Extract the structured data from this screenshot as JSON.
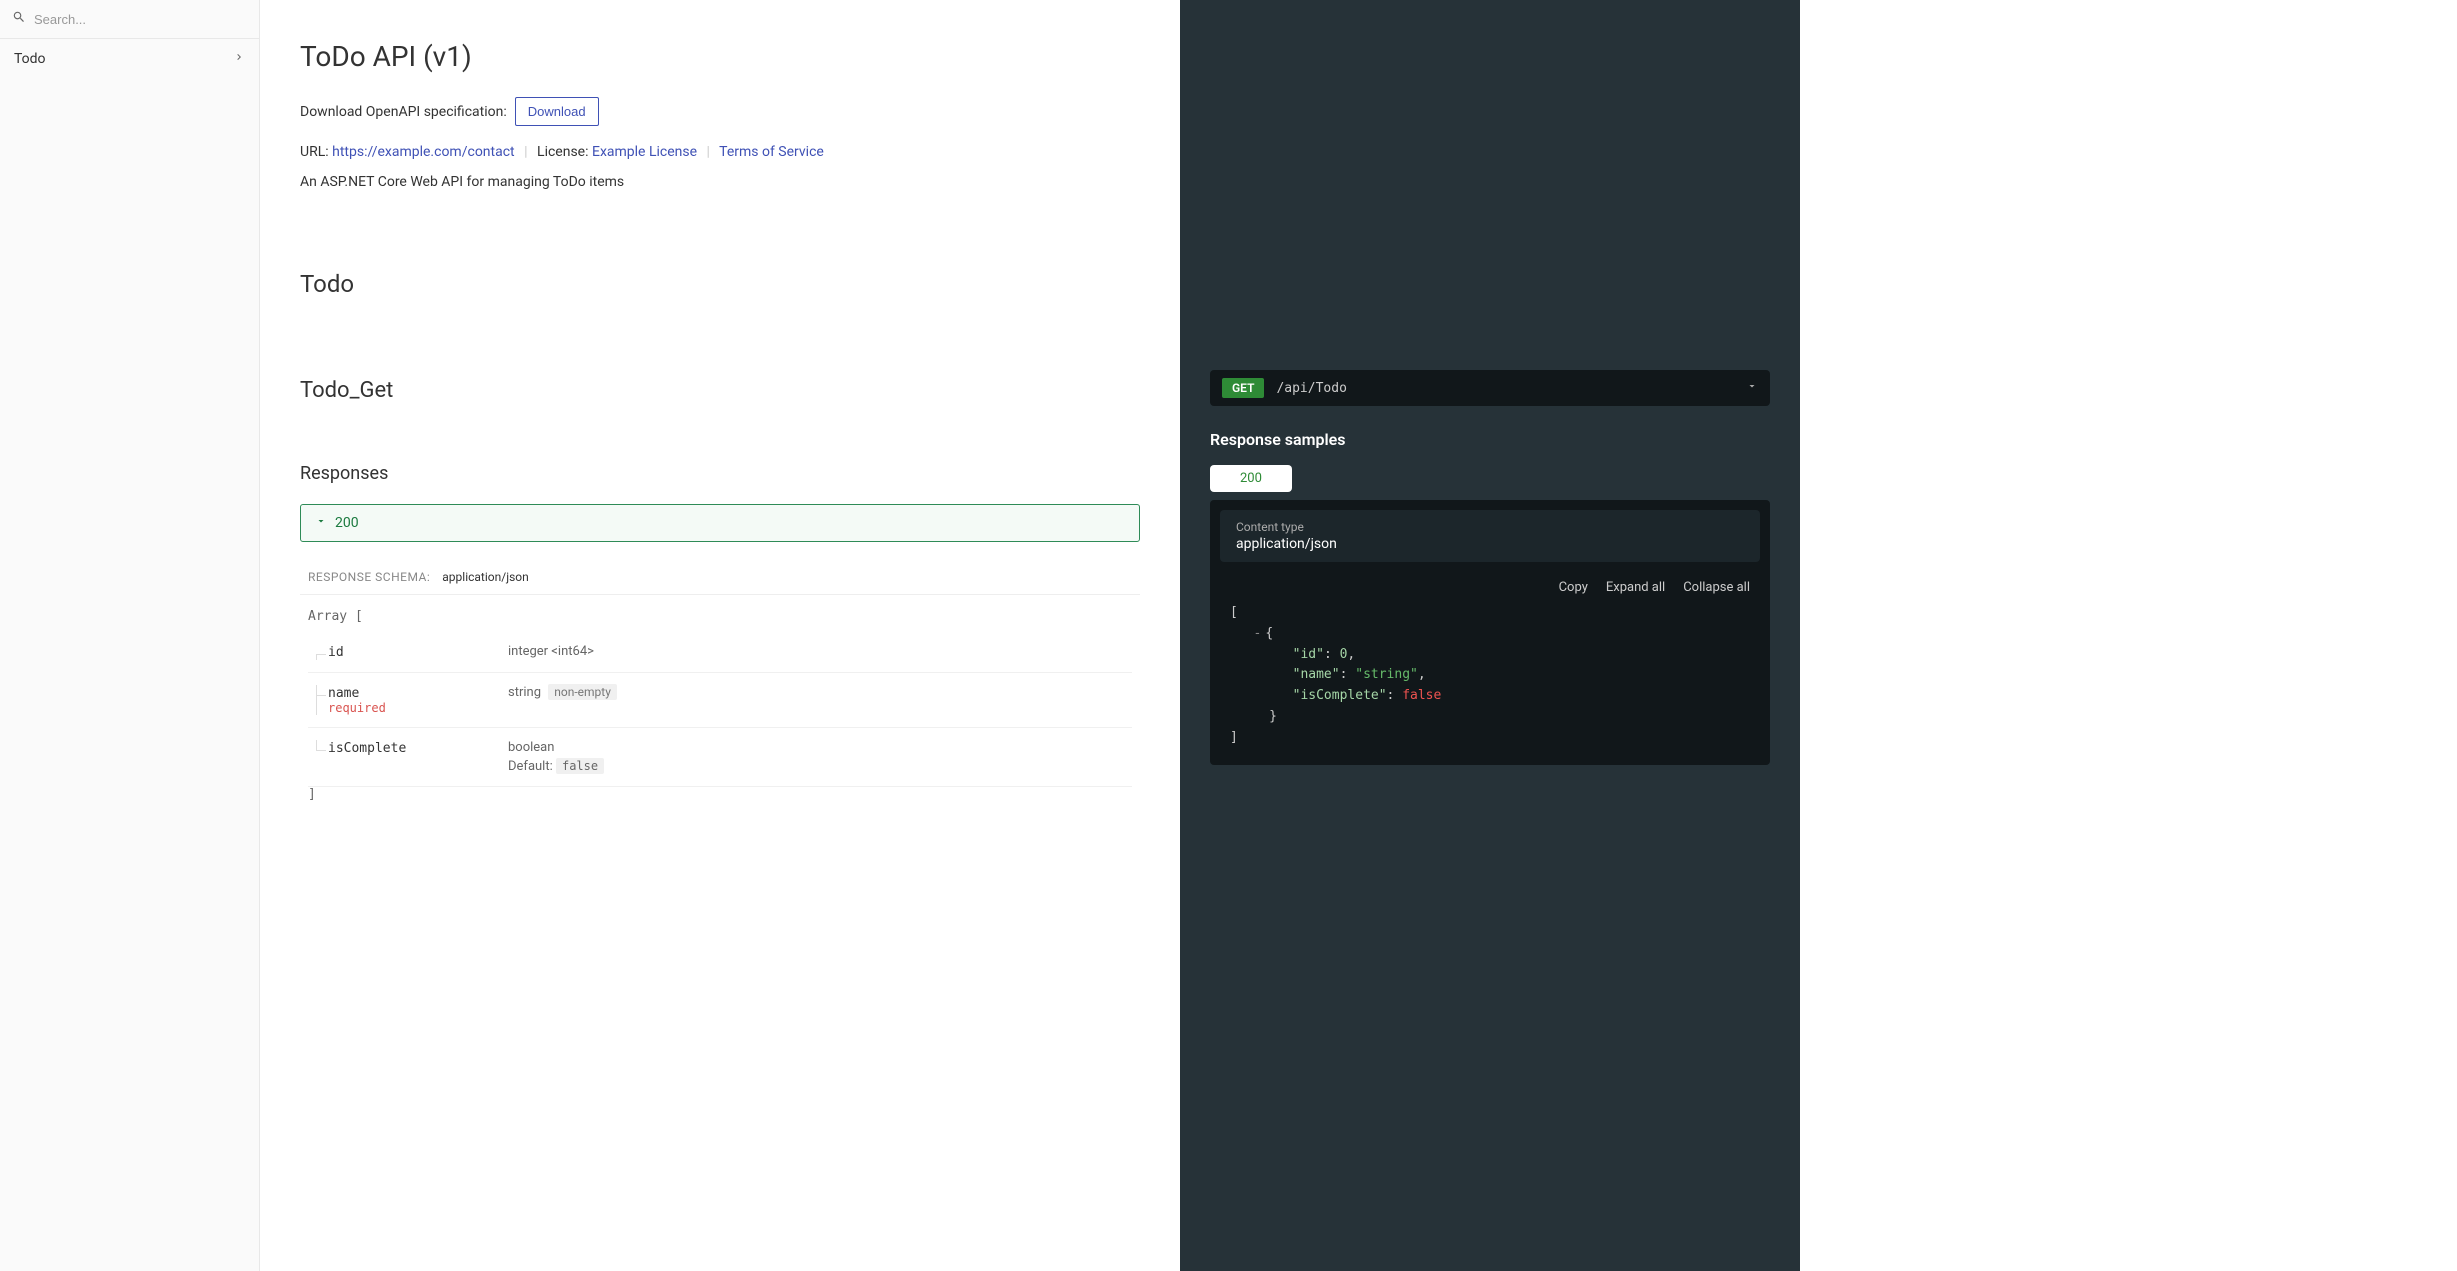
{
  "sidebar": {
    "search_placeholder": "Search...",
    "items": [
      {
        "label": "Todo"
      }
    ]
  },
  "header": {
    "title": "ToDo API (v1)",
    "spec_label": "Download OpenAPI specification:",
    "download_label": "Download",
    "url_label": "URL: ",
    "url_value": "https://example.com/contact",
    "license_label": "License: ",
    "license_value": "Example License",
    "tos_label": "Terms of Service",
    "description": "An ASP.NET Core Web API for managing ToDo items"
  },
  "tag": {
    "name": "Todo"
  },
  "operation": {
    "name": "Todo_Get",
    "responses_label": "Responses",
    "response_code": "200",
    "schema_label": "RESPONSE SCHEMA:",
    "schema_media": "application/json",
    "array_open": "Array [",
    "array_close": "]",
    "properties": [
      {
        "name": "id",
        "type": "integer <int64>"
      },
      {
        "name": "name",
        "required": "required",
        "type": "string",
        "constraint": "non-empty"
      },
      {
        "name": "isComplete",
        "type": "boolean",
        "default_label": "Default:",
        "default_value": "false"
      }
    ]
  },
  "right": {
    "method": "GET",
    "path": "/api/Todo",
    "samples_title": "Response samples",
    "tab_label": "200",
    "content_type_label": "Content type",
    "content_type_value": "application/json",
    "actions": {
      "copy": "Copy",
      "expand": "Expand all",
      "collapse": "Collapse all"
    },
    "sample": {
      "open_bracket": "[",
      "obj_open": "{",
      "k_id": "\"id\"",
      "v_id": "0",
      "k_name": "\"name\"",
      "v_name": "\"string\"",
      "k_isc": "\"isComplete\"",
      "v_isc": "false",
      "obj_close": "}",
      "close_bracket": "]",
      "collapse_glyph": "-"
    }
  }
}
